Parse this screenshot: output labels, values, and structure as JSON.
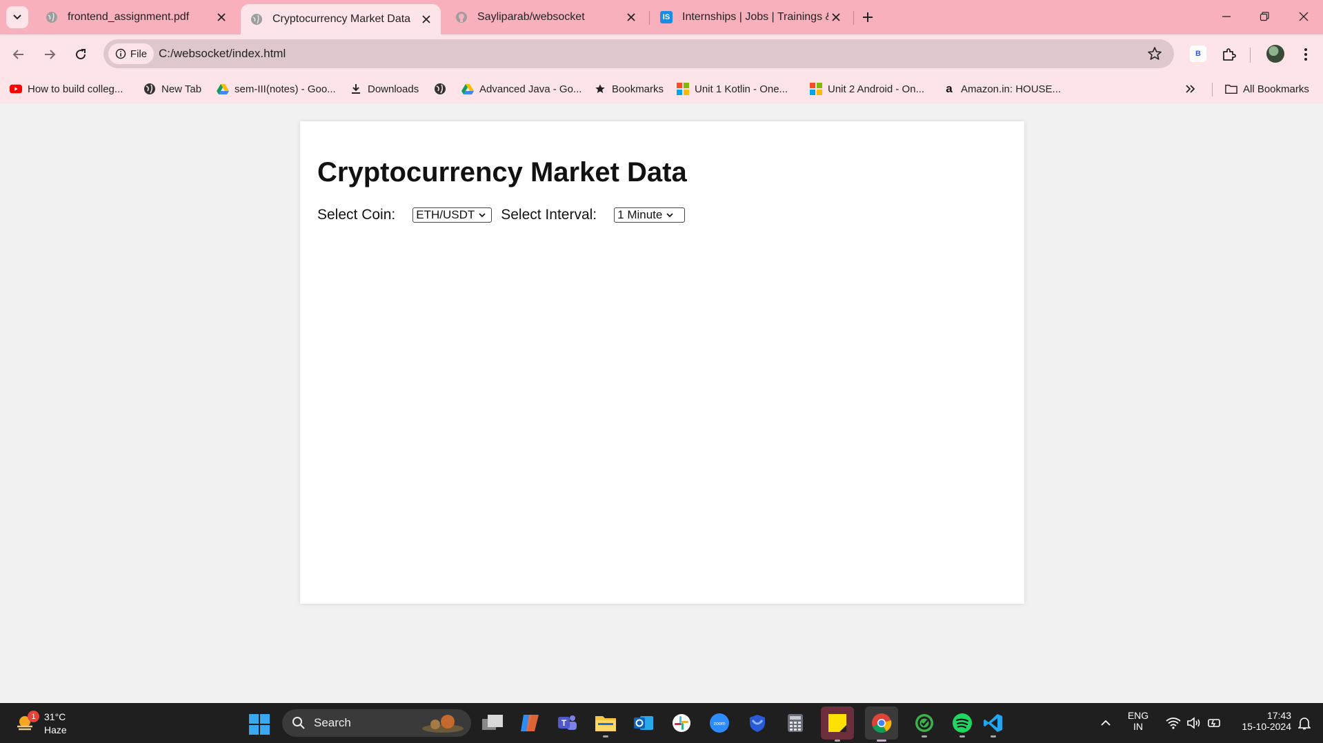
{
  "browser": {
    "tabs": [
      {
        "title": "frontend_assignment.pdf",
        "favicon": "globe-icon"
      },
      {
        "title": "Cryptocurrency Market Data",
        "favicon": "globe-icon",
        "active": true
      },
      {
        "title": "Sayliparab/websocket",
        "favicon": "github-icon"
      },
      {
        "title": "Internships | Jobs | Trainings & E",
        "favicon": "internshala-icon"
      }
    ],
    "address": {
      "chip_label": "File",
      "url": "C:/websocket/index.html"
    },
    "extension_label": "B",
    "bookmarks": [
      {
        "label": "How to build colleg...",
        "icon": "youtube-icon"
      },
      {
        "label": "New Tab",
        "icon": "globe-icon"
      },
      {
        "label": "sem-III(notes) - Goo...",
        "icon": "google-drive-icon"
      },
      {
        "label": "Downloads",
        "icon": "download-icon"
      },
      {
        "label": "",
        "icon": "globe-icon"
      },
      {
        "label": "Advanced Java - Go...",
        "icon": "google-drive-icon"
      },
      {
        "label": "Bookmarks",
        "icon": "star-icon"
      },
      {
        "label": "Unit 1 Kotlin - One...",
        "icon": "microsoft-icon"
      },
      {
        "label": "Unit 2 Android - On...",
        "icon": "microsoft-icon"
      },
      {
        "label": "Amazon.in: HOUSE...",
        "icon": "amazon-icon"
      }
    ],
    "all_bookmarks_label": "All Bookmarks"
  },
  "page": {
    "heading": "Cryptocurrency Market Data",
    "coin_label": "Select Coin:",
    "coin_value": "ETH/USDT",
    "interval_label": "Select Interval:",
    "interval_value": "1 Minute"
  },
  "taskbar": {
    "weather": {
      "badge": "1",
      "temp": "31°C",
      "condition": "Haze"
    },
    "search_label": "Search",
    "language": {
      "line1": "ENG",
      "line2": "IN"
    },
    "time": "17:43",
    "date": "15-10-2024"
  }
}
